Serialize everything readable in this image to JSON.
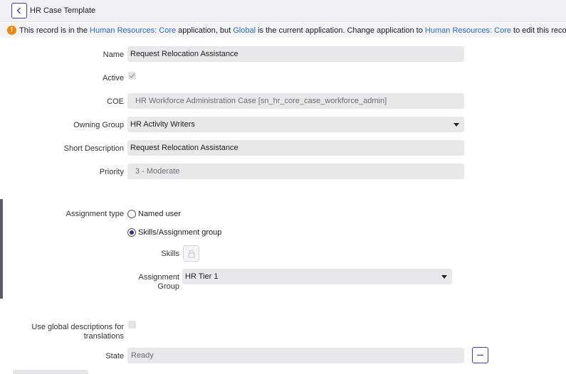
{
  "header": {
    "title": "HR Case Template",
    "back_icon": "chevron-left-icon"
  },
  "banner": {
    "icon": "warning-icon",
    "t1": "This record is in the",
    "link1": "Human Resources: Core",
    "t2": "application, but",
    "link2": "Global",
    "t3": "is the current application. Change application to",
    "link3": "Human Resources: Core",
    "t4": "to edit this record."
  },
  "form": {
    "name": {
      "label": "Name",
      "value": "Request Relocation Assistance"
    },
    "active": {
      "label": "Active",
      "checked": true
    },
    "coe": {
      "label": "COE",
      "value": "HR Workforce Administration Case [sn_hr_core_case_workforce_admin]"
    },
    "owning_group": {
      "label": "Owning Group",
      "value": "HR Activity Writers"
    },
    "short_description": {
      "label": "Short Description",
      "value": "Request Relocation Assistance"
    },
    "priority": {
      "label": "Priority",
      "value": "3 - Moderate"
    },
    "assignment_type": {
      "label": "Assignment type",
      "options": [
        "Named user",
        "Skills/Assignment group"
      ],
      "selected": "Skills/Assignment group"
    },
    "skills": {
      "label": "Skills",
      "icon": "lock-icon"
    },
    "assignment_group": {
      "label_line1": "Assignment",
      "label_line2": "Group",
      "value": "HR Tier 1"
    },
    "use_global": {
      "label_line1": "Use global descriptions for",
      "label_line2": "translations",
      "checked": false
    },
    "state": {
      "label": "State",
      "value": "Ready",
      "icon": "minus-icon"
    }
  }
}
